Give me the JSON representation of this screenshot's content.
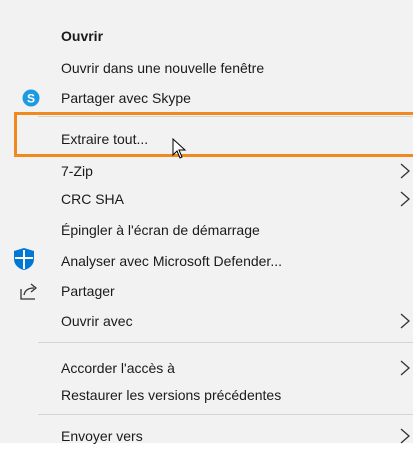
{
  "menu": {
    "items": [
      {
        "label": "Ouvrir",
        "bold": true,
        "icon": "",
        "submenu": false
      },
      {
        "label": "Ouvrir dans une nouvelle fenêtre",
        "icon": "",
        "submenu": false
      },
      {
        "label": "Partager avec Skype",
        "icon": "skype-icon",
        "submenu": false
      },
      {
        "label": "Extraire tout...",
        "icon": "",
        "submenu": false,
        "highlighted": true
      },
      {
        "label": "7-Zip",
        "icon": "",
        "submenu": true
      },
      {
        "label": "CRC SHA",
        "icon": "",
        "submenu": true
      },
      {
        "label": "Épingler à l'écran de démarrage",
        "icon": "",
        "submenu": false
      },
      {
        "label": "Analyser avec Microsoft Defender...",
        "icon": "defender-icon",
        "submenu": false
      },
      {
        "label": "Partager",
        "icon": "share-icon",
        "submenu": false
      },
      {
        "label": "Ouvrir avec",
        "icon": "",
        "submenu": true
      },
      {
        "label": "Accorder l'accès à",
        "icon": "",
        "submenu": true
      },
      {
        "label": "Restaurer les versions précédentes",
        "icon": "",
        "submenu": false
      },
      {
        "label": "Envoyer vers",
        "icon": "",
        "submenu": true
      }
    ]
  },
  "colors": {
    "highlight_border": "#f08a1e",
    "skype_blue": "#1e9be0",
    "defender_blue": "#0078d4",
    "menu_background": "#f2f2f2"
  }
}
